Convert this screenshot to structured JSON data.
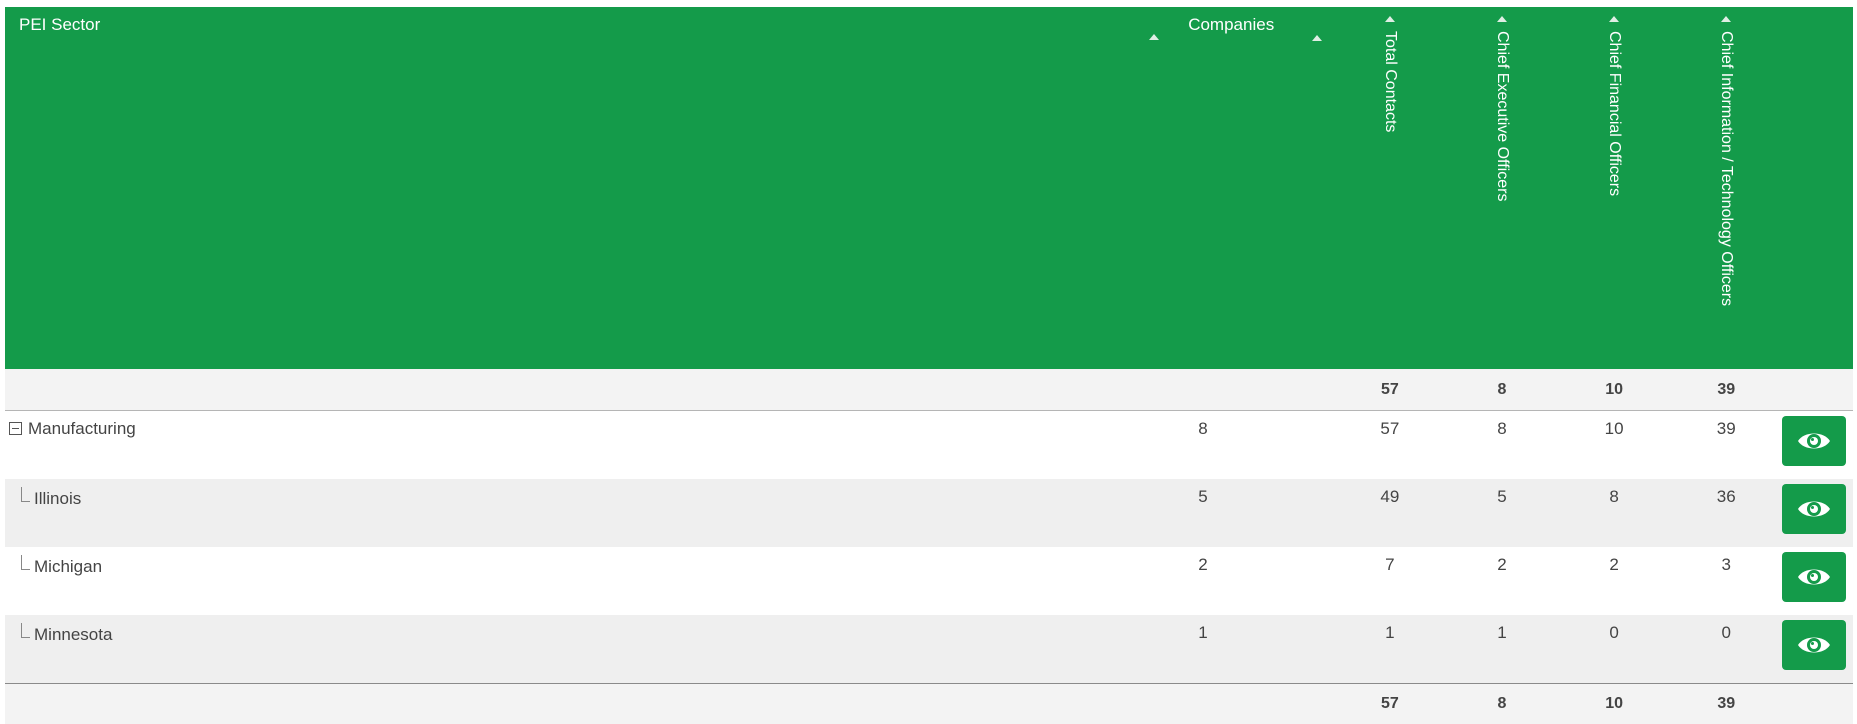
{
  "columns": {
    "sector": "PEI Sector",
    "companies": "Companies",
    "total_contacts": "Total Contacts",
    "ceo": "Chief Executive Officers",
    "cfo": "Chief Financial Officers",
    "cio": "Chief Information / Technology Officers"
  },
  "summary_top": {
    "total": "57",
    "ceo": "8",
    "cfo": "10",
    "cio": "39"
  },
  "rows": [
    {
      "name": "Manufacturing",
      "companies": "8",
      "total": "57",
      "ceo": "8",
      "cfo": "10",
      "cio": "39",
      "level": "parent",
      "expanded": true
    },
    {
      "name": "Illinois",
      "companies": "5",
      "total": "49",
      "ceo": "5",
      "cfo": "8",
      "cio": "36",
      "level": "child"
    },
    {
      "name": "Michigan",
      "companies": "2",
      "total": "7",
      "ceo": "2",
      "cfo": "2",
      "cio": "3",
      "level": "child"
    },
    {
      "name": "Minnesota",
      "companies": "1",
      "total": "1",
      "ceo": "1",
      "cfo": "0",
      "cio": "0",
      "level": "child"
    }
  ],
  "summary_bottom": {
    "total": "57",
    "ceo": "8",
    "cfo": "10",
    "cio": "39"
  },
  "icons": {
    "view": "eye-icon",
    "collapse": "minus-square-icon",
    "sort": "sort-ascending-icon",
    "child": "tree-branch-icon"
  },
  "colors": {
    "header_bg": "#149b4a",
    "button_bg": "#149b4a",
    "alt_row": "#efefef"
  }
}
